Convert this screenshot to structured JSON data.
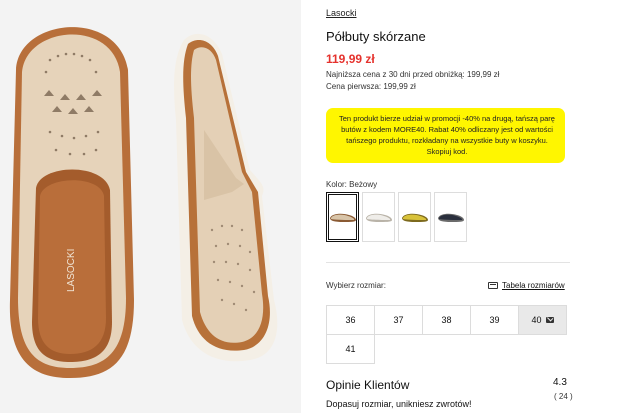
{
  "product": {
    "brand": "Lasocki",
    "title": "Półbuty skórzane",
    "price": "119,99 zł",
    "lowest_price_note": "Najniższa cena z 30 dni przed obniżką: 199,99 zł",
    "first_price_note": "Cena pierwsza: 199,99 zł"
  },
  "promo": {
    "text": "Ten produkt bierze udział w promocji -40% na drugą, tańszą parę butów z kodem MORE40. Rabat 40% odliczany jest od wartości tańszego produktu, rozkładany na wszystkie buty w koszyku. Skopiuj kod.",
    "background": "#fff600"
  },
  "color": {
    "label": "Kolor: Beżowy",
    "swatches": [
      {
        "name": "beige",
        "color": "#d8c4a8",
        "selected": true
      },
      {
        "name": "white",
        "color": "#e8e6e2",
        "selected": false
      },
      {
        "name": "yellow",
        "color": "#d8c23a",
        "selected": false
      },
      {
        "name": "navy",
        "color": "#2a2f3d",
        "selected": false
      }
    ]
  },
  "sizes": {
    "label": "Wybierz rozmiar:",
    "table_link": "Tabela rozmiarów",
    "options": [
      {
        "label": "36",
        "available": true
      },
      {
        "label": "37",
        "available": true
      },
      {
        "label": "38",
        "available": true
      },
      {
        "label": "39",
        "available": true
      },
      {
        "label": "40",
        "available": false
      },
      {
        "label": "41",
        "available": true
      }
    ]
  },
  "reviews": {
    "title": "Opinie Klientów",
    "rating": "4.3",
    "count": "( 24 )",
    "subtitle": "Dopasuj rozmiar, unikniesz zwrotów!"
  },
  "photo": {
    "insole_brand": "LASOCKI"
  },
  "colors": {
    "price_red": "#e5322d",
    "shoe_leather": "#e3cfb4",
    "sole_brown": "#b06a35"
  }
}
